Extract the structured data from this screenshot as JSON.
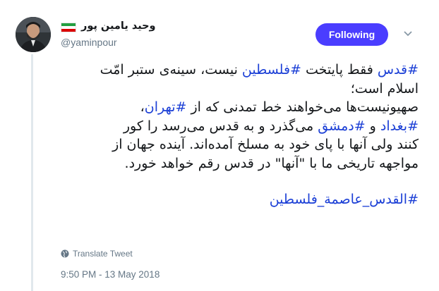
{
  "author": {
    "name": "وحید یامین پور",
    "handle": "@yaminpour",
    "flag_icon": "iran-flag-icon"
  },
  "follow_button": {
    "label": "Following",
    "color": "#4a3dff"
  },
  "tweet": {
    "lines": [
      [
        {
          "t": "#قدس",
          "tag": true
        },
        {
          "t": " فقط پایتخت "
        },
        {
          "t": "#فلسطین",
          "tag": true
        },
        {
          "t": " نیست، سینه‌ی ستبر امّت"
        }
      ],
      [
        {
          "t": "اسلام است؛"
        }
      ],
      [
        {
          "t": "صهیونیست‌ها می‌خواهند خط تمدنی که از "
        },
        {
          "t": "#تهران",
          "tag": true
        },
        {
          "t": "،"
        }
      ],
      [
        {
          "t": "#بغداد",
          "tag": true
        },
        {
          "t": " و "
        },
        {
          "t": "#دمشق",
          "tag": true
        },
        {
          "t": " می‌گذرد و به قدس می‌رسد را کور"
        }
      ],
      [
        {
          "t": "کنند ولی آنها با پای خود به مسلخ آمده‌اند. آینده جهان از"
        }
      ],
      [
        {
          "t": "مواجهه تاریخی ما با \"آنها\" در قدس رقم خواهد خورد."
        }
      ],
      [],
      [
        {
          "t": "#القدس_عاصمة_فلسطين",
          "tag": true
        }
      ]
    ],
    "hashtag_color": "#1b3fd6"
  },
  "translate_label": "Translate Tweet",
  "timestamp": "9:50 PM - 13 May 2018"
}
